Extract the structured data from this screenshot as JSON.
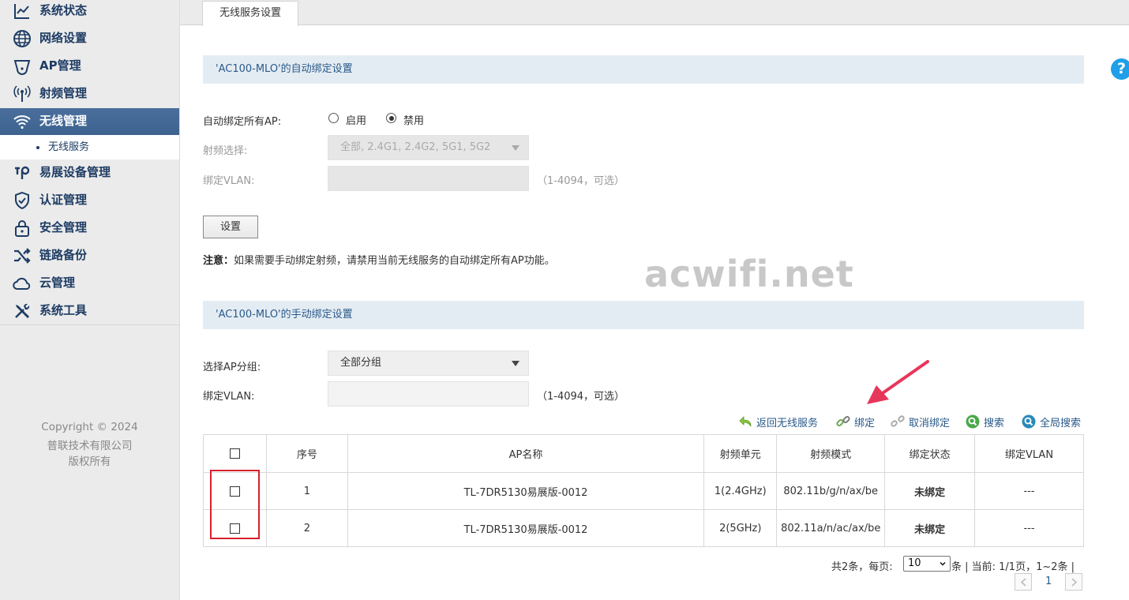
{
  "sidebar": {
    "items": [
      {
        "label": "系统状态",
        "icon": "chart-line-icon"
      },
      {
        "label": "网络设置",
        "icon": "globe-icon"
      },
      {
        "label": "AP管理",
        "icon": "access-point-icon"
      },
      {
        "label": "射频管理",
        "icon": "antenna-icon"
      },
      {
        "label": "无线管理",
        "icon": "wifi-icon",
        "active": true
      },
      {
        "label": "易展设备管理",
        "icon": "mesh-device-icon"
      },
      {
        "label": "认证管理",
        "icon": "shield-check-icon"
      },
      {
        "label": "安全管理",
        "icon": "lock-icon"
      },
      {
        "label": "链路备份",
        "icon": "shuffle-icon"
      },
      {
        "label": "云管理",
        "icon": "cloud-icon"
      },
      {
        "label": "系统工具",
        "icon": "tools-icon"
      }
    ],
    "sub_item": "无线服务",
    "copyright": [
      "Copyright © 2024",
      "普联技术有限公司",
      "版权所有"
    ]
  },
  "tab": {
    "label": "无线服务设置"
  },
  "auto_bind": {
    "section_title": "'AC100-MLO'的自动绑定设置",
    "bind_all_label": "自动绑定所有AP:",
    "enable_label": "启用",
    "disable_label": "禁用",
    "selected": "disable",
    "radio_select_label": "射频选择:",
    "radio_select_value": "全部, 2.4G1, 2.4G2, 5G1, 5G2",
    "vlan_label": "绑定VLAN:",
    "vlan_hint": "（1-4094，可选）",
    "set_button": "设置",
    "note_prefix": "注意：",
    "note_text": "如果需要手动绑定射频，请禁用当前无线服务的自动绑定所有AP功能。"
  },
  "watermark": "acwifi.net",
  "manual_bind": {
    "section_title": "'AC100-MLO'的手动绑定设置",
    "group_label": "选择AP分组:",
    "group_value": "全部分组",
    "vlan_label": "绑定VLAN:",
    "vlan_hint": "（1-4094，可选）"
  },
  "toolbar": {
    "back": "返回无线服务",
    "bind": "绑定",
    "unbind": "取消绑定",
    "search": "搜索",
    "global_search": "全局搜索"
  },
  "table": {
    "headers": [
      "序号",
      "AP名称",
      "射频单元",
      "射频模式",
      "绑定状态",
      "绑定VLAN"
    ],
    "rows": [
      {
        "index": "1",
        "ap_name": "TL-7DR5130易展版-0012",
        "radio_unit": "1(2.4GHz)",
        "radio_mode": "802.11b/g/n/ax/be",
        "status": "未绑定",
        "vlan": "---"
      },
      {
        "index": "2",
        "ap_name": "TL-7DR5130易展版-0012",
        "radio_unit": "2(5GHz)",
        "radio_mode": "802.11a/n/ac/ax/be",
        "status": "未绑定",
        "vlan": "---"
      }
    ]
  },
  "pager": {
    "total_text": "共2条，每页:",
    "page_size": "10",
    "info_text": "条 | 当前: 1/1页，1~2条 |",
    "current_page": "1"
  },
  "colors": {
    "accent": "#3d628f",
    "link": "#2a5a8a",
    "highlight_box": "#d7202c",
    "help": "#1e9fe8"
  }
}
